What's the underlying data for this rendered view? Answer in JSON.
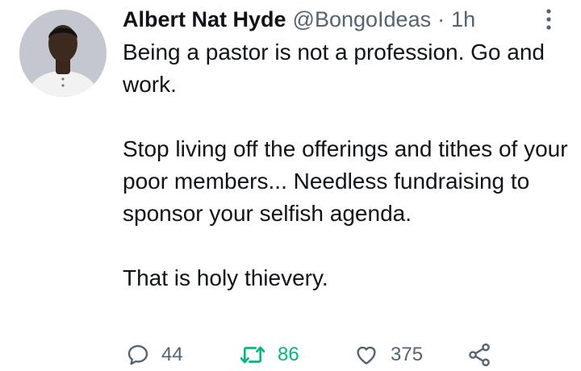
{
  "tweet": {
    "author": {
      "display_name": "Albert Nat Hyde",
      "handle": "@BongoIdeas",
      "separator": "·",
      "timestamp": "1h",
      "avatar_icon": "profile-photo"
    },
    "text": {
      "line1": "Being a pastor is not a profession. Go and work.",
      "para2": "Stop living off the offerings and tithes of your poor members... Needless fundraising to sponsor your selfish agenda.",
      "para3": "That is holy thievery."
    },
    "actions": {
      "reply_count": "44",
      "retweet_count": "86",
      "like_count": "375",
      "reply_icon": "speech-bubble-icon",
      "retweet_icon": "retweet-arrows-icon",
      "like_icon": "heart-icon",
      "share_icon": "share-nodes-icon",
      "more_icon": "vertical-dots-icon"
    },
    "colors": {
      "text_primary": "#0f1419",
      "text_secondary": "#536471",
      "retweeted": "#00ba7c"
    }
  }
}
